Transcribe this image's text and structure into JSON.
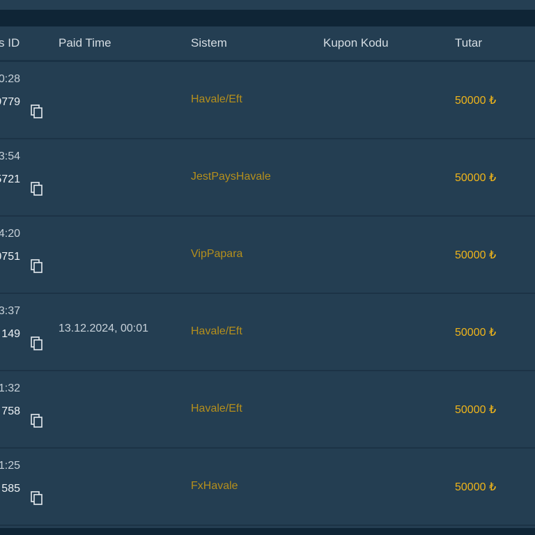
{
  "table": {
    "headers": {
      "id": "s ID",
      "paid_time": "Paid Time",
      "sistem": "Sistem",
      "kupon_kodu": "Kupon Kodu",
      "tutar": "Tutar"
    },
    "rows": [
      {
        "time": "0:28",
        "id": "9779",
        "paid_time": "",
        "sistem": "Havale/Eft",
        "kupon": "",
        "tutar": "50000 ₺"
      },
      {
        "time": "3:54",
        "id": "5721",
        "paid_time": "",
        "sistem": "JestPaysHavale",
        "kupon": "",
        "tutar": "50000 ₺"
      },
      {
        "time": "4:20",
        "id": "0751",
        "paid_time": "",
        "sistem": "VipPapara",
        "kupon": "",
        "tutar": "50000 ₺"
      },
      {
        "time": "3:37",
        "id": "149",
        "paid_time": "13.12.2024, 00:01",
        "sistem": "Havale/Eft",
        "kupon": "",
        "tutar": "50000 ₺"
      },
      {
        "time": "1:32",
        "id": "758",
        "paid_time": "",
        "sistem": "Havale/Eft",
        "kupon": "",
        "tutar": "50000 ₺"
      },
      {
        "time": "1:25",
        "id": "585",
        "paid_time": "",
        "sistem": "FxHavale",
        "kupon": "",
        "tutar": "50000 ₺"
      }
    ]
  },
  "icons": {
    "copy": "copy-icon"
  },
  "colors": {
    "background": "#243e52",
    "band": "#0f2536",
    "sistem_text": "#b58f1c",
    "amount_text": "#f0b51a"
  }
}
